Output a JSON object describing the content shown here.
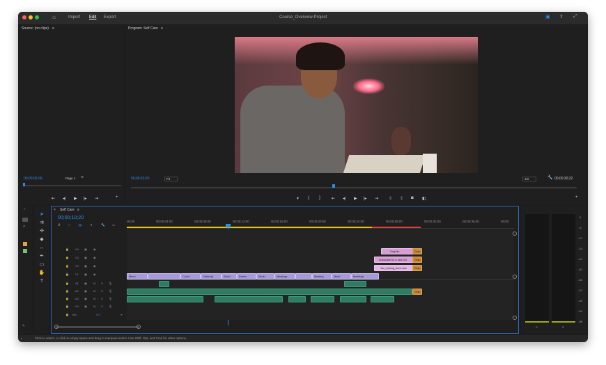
{
  "titlebar": {
    "tabs": [
      "Import",
      "Edit",
      "Export"
    ],
    "active_tab": "Edit",
    "project": "Course_Overview-Project"
  },
  "source": {
    "title": "Source: (no clips)",
    "timecode": "00;00;00;00",
    "page": "Page 1"
  },
  "program": {
    "title": "Program: Self Care",
    "timecode": "00;00;10;20",
    "fit": "Fit",
    "resolution": "1/2",
    "duration": "00;00;30;22"
  },
  "timeline": {
    "sequence": "Self Care",
    "timecode": "00;00;10;20",
    "ruler": [
      "00;00",
      "00;00;04;00",
      "00;00;08;00",
      "00;00;12;00",
      "00;00;16;00",
      "00;00;20;00",
      "00;00;24;00",
      "00;00;28;00",
      "00;00;32;00",
      "00;00;36;00",
      "00;00"
    ],
    "video_tracks": [
      "V4",
      "V3",
      "V2",
      "V1"
    ],
    "audio_tracks": [
      "A1",
      "A2",
      "A3",
      "A4"
    ],
    "mix_label": "Mix",
    "mix_value": "0.0",
    "v1_clips": [
      "Morni",
      "",
      "Count",
      "Ordering",
      "Worki",
      "Restin",
      "Worki",
      "Meetings",
      "",
      "Meeting",
      "Meeti",
      "Meetings"
    ],
    "v4_clip": "Graphic",
    "v4_tag": "Grap",
    "v3_clip": "Subscribe for a new Ori",
    "v3_tag": "Grap",
    "v2_clip": "You_belong_here.mov",
    "v2_tag": "Grap",
    "a1_tag": "Grap"
  },
  "meter": {
    "scale": [
      "0",
      "-6",
      "-12",
      "-18",
      "-24",
      "-30",
      "-36",
      "-42",
      "-48",
      "-54",
      "-dB"
    ],
    "bottom": [
      "S",
      "S"
    ]
  },
  "status": "Click to select, or click in empty space and drag to marquee select. Use Shift, Opt, and Cmd for other options.",
  "colors": {
    "accent": "#2d8ceb",
    "video_clip": "#a79bd6",
    "graphic_clip": "#d59ed6",
    "audio_clip": "#2e7d62",
    "work_bar": "#e6c200",
    "in_out": "#e04040"
  }
}
